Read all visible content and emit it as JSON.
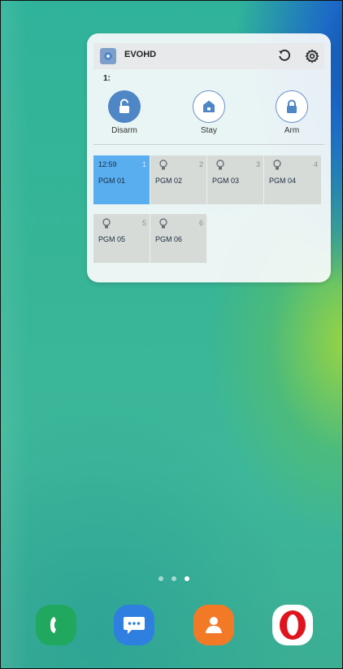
{
  "widget": {
    "app_title": "EVOHD",
    "area_label": "1:",
    "modes": [
      {
        "label": "Disarm",
        "active": true
      },
      {
        "label": "Stay",
        "active": false
      },
      {
        "label": "Arm",
        "active": false
      }
    ],
    "pgms": [
      {
        "name": "PGM 01",
        "number": "1",
        "time": "12:59",
        "active": true
      },
      {
        "name": "PGM 02",
        "number": "2",
        "active": false
      },
      {
        "name": "PGM 03",
        "number": "3",
        "active": false
      },
      {
        "name": "PGM 04",
        "number": "4",
        "active": false
      },
      {
        "name": "PGM 05",
        "number": "5",
        "active": false
      },
      {
        "name": "PGM 06",
        "number": "6",
        "active": false
      }
    ]
  },
  "icons": {
    "refresh": "refresh-icon",
    "settings": "gear-icon",
    "disarm": "unlocked-padlock-icon",
    "stay": "house-icon",
    "arm": "locked-padlock-icon",
    "pgm": "lightbulb-icon"
  },
  "home_pages": {
    "count": 3,
    "current": 3
  },
  "dock": [
    {
      "app": "phone-icon"
    },
    {
      "app": "messages-icon"
    },
    {
      "app": "contacts-icon"
    },
    {
      "app": "opera-icon"
    }
  ],
  "colors": {
    "accent": "#4f86c6",
    "pgm_active": "#59aef0",
    "pgm_idle": "#d6dbd8"
  }
}
